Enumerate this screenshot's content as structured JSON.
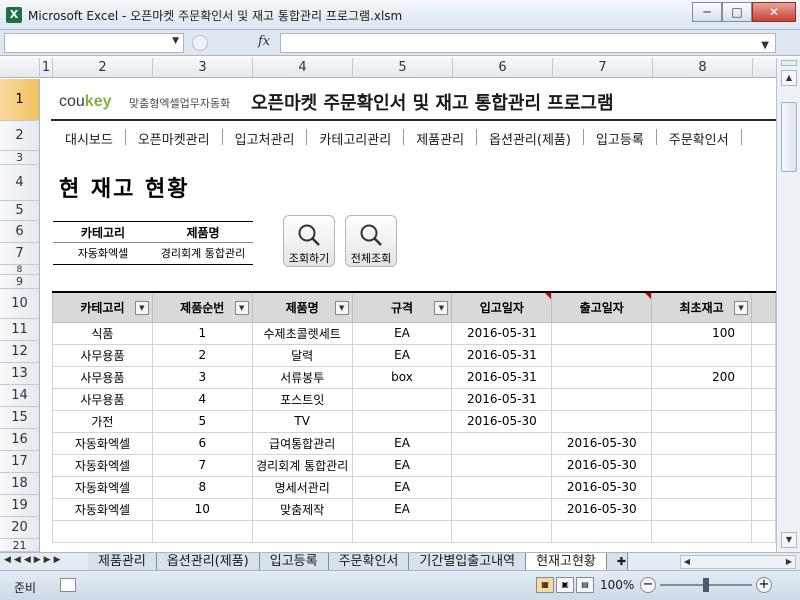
{
  "window": {
    "title": "Microsoft Excel - 오픈마켓 주문확인서 및 재고 통합관리 프로그램.xlsm",
    "controls": [
      "─",
      "□",
      "✕"
    ]
  },
  "formula_bar": {
    "fx_label": "fx"
  },
  "columns": [
    "1",
    "2",
    "3",
    "4",
    "5",
    "6",
    "7",
    "8"
  ],
  "rows": [
    "1",
    "2",
    "3",
    "4",
    "5",
    "6",
    "7",
    "8",
    "9",
    "10",
    "11",
    "12",
    "13",
    "14",
    "15",
    "16",
    "17",
    "18",
    "19",
    "20",
    "21"
  ],
  "header": {
    "brand_main": "cou",
    "brand_accent": "key",
    "brand_sub": "맞춤형엑셀업무자동화",
    "app_title": "오픈마켓 주문확인서 및 재고 통합관리 프로그램"
  },
  "nav": [
    "대시보드",
    "오픈마켓관리",
    "입고처관리",
    "카테고리관리",
    "제품관리",
    "옵션관리(제품)",
    "입고등록",
    "주문확인서"
  ],
  "section_title": "현 재고 현황",
  "filter": {
    "headers": [
      "카테고리",
      "제품명"
    ],
    "values": [
      "자동화엑셀",
      "경리회계 통합관리"
    ]
  },
  "buttons": {
    "search": "조회하기",
    "all": "전체조회"
  },
  "table": {
    "headers": [
      "카테고리",
      "제품순번",
      "제품명",
      "규격",
      "입고일자",
      "출고일자",
      "최초재고"
    ],
    "rows": [
      [
        "식품",
        "1",
        "수제초콜렛세트",
        "EA",
        "2016-05-31",
        "",
        "100"
      ],
      [
        "사무용품",
        "2",
        "달력",
        "EA",
        "2016-05-31",
        "",
        ""
      ],
      [
        "사무용품",
        "3",
        "서류봉투",
        "box",
        "2016-05-31",
        "",
        "200"
      ],
      [
        "사무용품",
        "4",
        "포스트잇",
        "",
        "2016-05-31",
        "",
        ""
      ],
      [
        "가전",
        "5",
        "TV",
        "",
        "2016-05-30",
        "",
        ""
      ],
      [
        "자동화엑셀",
        "6",
        "급여통합관리",
        "EA",
        "",
        "2016-05-30",
        ""
      ],
      [
        "자동화엑셀",
        "7",
        "경리회계 통합관리",
        "EA",
        "",
        "2016-05-30",
        ""
      ],
      [
        "자동화엑셀",
        "8",
        "명세서관리",
        "EA",
        "",
        "2016-05-30",
        ""
      ],
      [
        "자동화엑셀",
        "10",
        "맞춤제작",
        "EA",
        "",
        "2016-05-30",
        ""
      ],
      [
        "",
        "",
        "",
        "",
        "",
        "",
        ""
      ]
    ]
  },
  "sheet_tabs": [
    "제품관리",
    "옵션관리(제품)",
    "입고등록",
    "주문확인서",
    "기간별입출고내역",
    "현재고현황"
  ],
  "active_tab": "현재고현황",
  "status": {
    "mode": "준비",
    "zoom": "100%"
  },
  "colors": {
    "accent_green": "#83b23c",
    "header_gray": "#d9d9d9",
    "row_select": "#f1c15f"
  }
}
